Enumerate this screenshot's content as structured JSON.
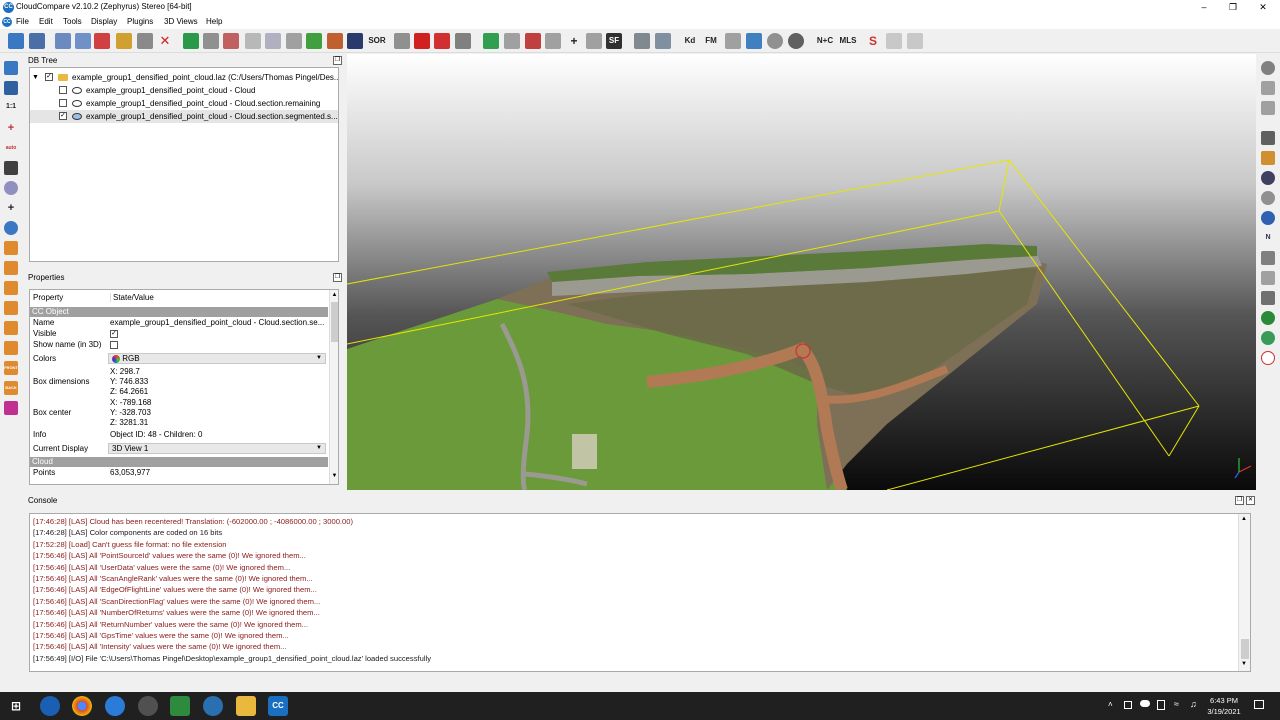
{
  "window": {
    "title": "CloudCompare v2.10.2 (Zephyrus) Stereo [64-bit]",
    "app_icon": "CC"
  },
  "menu": [
    "File",
    "Edit",
    "Tools",
    "Display",
    "Plugins",
    "3D Views",
    "Help"
  ],
  "toolbar_text": {
    "sor": "SOR",
    "sf": "SF",
    "kd": "Kd",
    "fm": "FM",
    "nc": "N+C",
    "mls": "MLS"
  },
  "left_toolbar_text": {
    "one_to_one": "1:1",
    "auto": "auto",
    "front": "FRONT",
    "back": "BACK"
  },
  "db_tree": {
    "header": "DB Tree",
    "items": [
      {
        "label": "example_group1_densified_point_cloud.laz (C:/Users/Thomas Pingel/Des...",
        "checked": true,
        "type": "folder"
      },
      {
        "label": "example_group1_densified_point_cloud - Cloud",
        "checked": false,
        "type": "cloud"
      },
      {
        "label": "example_group1_densified_point_cloud - Cloud.section.remaining",
        "checked": false,
        "type": "cloud"
      },
      {
        "label": "example_group1_densified_point_cloud - Cloud.section.segmented.s...",
        "checked": true,
        "type": "cloud",
        "selected": true
      }
    ]
  },
  "properties": {
    "header": "Properties",
    "col_property": "Property",
    "col_value": "State/Value",
    "section_cc_object": "CC Object",
    "name_label": "Name",
    "name_value": "example_group1_densified_point_cloud - Cloud.section.se...",
    "visible_label": "Visible",
    "visible_checked": true,
    "show_name_label": "Show name (in 3D)",
    "show_name_checked": false,
    "colors_label": "Colors",
    "colors_value": "RGB",
    "box_dim_label": "Box dimensions",
    "box_dim": [
      "X: 298.7",
      "Y: 746.833",
      "Z: 64.2661"
    ],
    "box_center_label": "Box center",
    "box_center": [
      "X: -789.168",
      "Y: -328.703",
      "Z: 3281.31"
    ],
    "info_label": "Info",
    "info_value": "Object ID: 48 - Children: 0",
    "current_display_label": "Current Display",
    "current_display_value": "3D View 1",
    "section_cloud": "Cloud",
    "points_label": "Points",
    "points_value": "63,053,977"
  },
  "console": {
    "header": "Console",
    "lines": [
      {
        "text": "[17:46:28] [LAS] Cloud has been recentered! Translation: (-602000.00 ; -4086000.00 ; 3000.00)",
        "level": "warn"
      },
      {
        "text": "[17:46:28] [LAS] Color components are coded on 16 bits",
        "level": "norm"
      },
      {
        "text": "[17:52:28] [Load] Can't guess file format: no file extension",
        "level": "warn"
      },
      {
        "text": "[17:56:46] [LAS] All 'PointSourceId' values were the same (0)! We ignored them...",
        "level": "warn"
      },
      {
        "text": "[17:56:46] [LAS] All 'UserData' values were the same (0)! We ignored them...",
        "level": "warn"
      },
      {
        "text": "[17:56:46] [LAS] All 'ScanAngleRank' values were the same (0)! We ignored them...",
        "level": "warn"
      },
      {
        "text": "[17:56:46] [LAS] All 'EdgeOfFlightLine' values were the same (0)! We ignored them...",
        "level": "warn"
      },
      {
        "text": "[17:56:46] [LAS] All 'ScanDirectionFlag' values were the same (0)! We ignored them...",
        "level": "warn"
      },
      {
        "text": "[17:56:46] [LAS] All 'NumberOfReturns' values were the same (0)! We ignored them...",
        "level": "warn"
      },
      {
        "text": "[17:56:46] [LAS] All 'ReturnNumber' values were the same (0)! We ignored them...",
        "level": "warn"
      },
      {
        "text": "[17:56:46] [LAS] All 'GpsTime' values were the same (0)! We ignored them...",
        "level": "warn"
      },
      {
        "text": "[17:56:46] [LAS] All 'Intensity' values were the same (0)! We ignored them...",
        "level": "warn"
      },
      {
        "text": "[17:56:49] [I/O] File 'C:\\Users\\Thomas Pingel\\Desktop\\example_group1_densified_point_cloud.laz' loaded successfully",
        "level": "norm"
      }
    ]
  },
  "taskbar": {
    "time": "6:43 PM",
    "date": "3/19/2021"
  },
  "colors": {
    "warn_text": "#8b1a1a",
    "bbox_line": "#e6e600",
    "selection": "#e5e5e5",
    "section": "#a0a0a0"
  }
}
